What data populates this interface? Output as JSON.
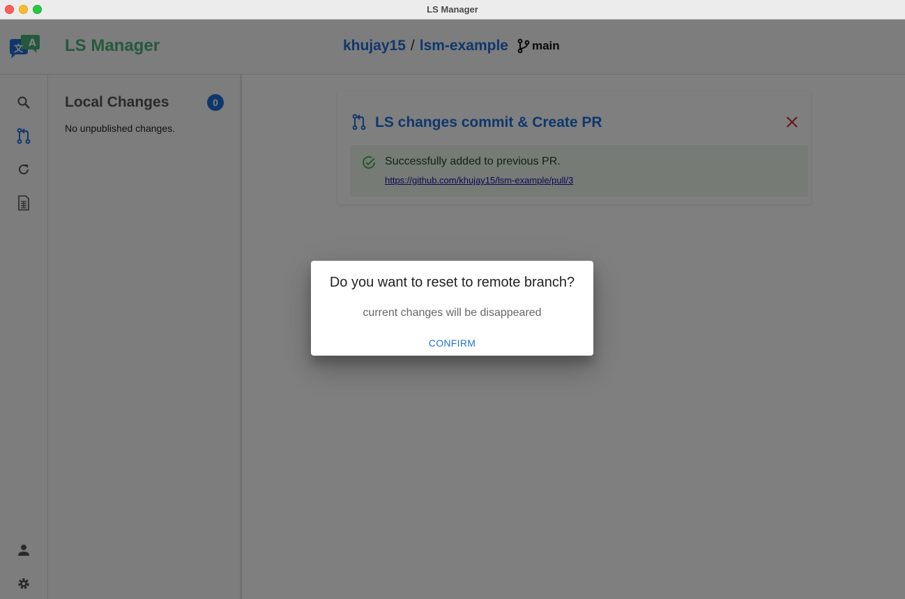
{
  "window": {
    "title": "LS Manager"
  },
  "header": {
    "brand": "LS Manager",
    "repo_owner": "khujay15",
    "separator": "/",
    "repo_name": "lsm-example",
    "branch": "main"
  },
  "sidebar": {
    "icons": [
      "search-icon",
      "pull-request-icon",
      "refresh-icon",
      "spreadsheet-icon",
      "person-icon",
      "gear-icon"
    ]
  },
  "local_changes": {
    "title": "Local Changes",
    "count": "0",
    "empty_text": "No unpublished changes."
  },
  "pr_card": {
    "title": "LS changes commit & Create PR",
    "success_message": "Successfully added to previous PR.",
    "pr_link": "https://github.com/khujay15/lsm-example/pull/3"
  },
  "dialog": {
    "title": "Do you want to reset to remote branch?",
    "text": "current changes will be disappeared",
    "confirm_label": "CONFIRM"
  },
  "colors": {
    "accent": "#1c6fd8",
    "brand_green": "#48b37b",
    "success_bg": "#edf7ed",
    "close_red": "#d32f2f"
  }
}
